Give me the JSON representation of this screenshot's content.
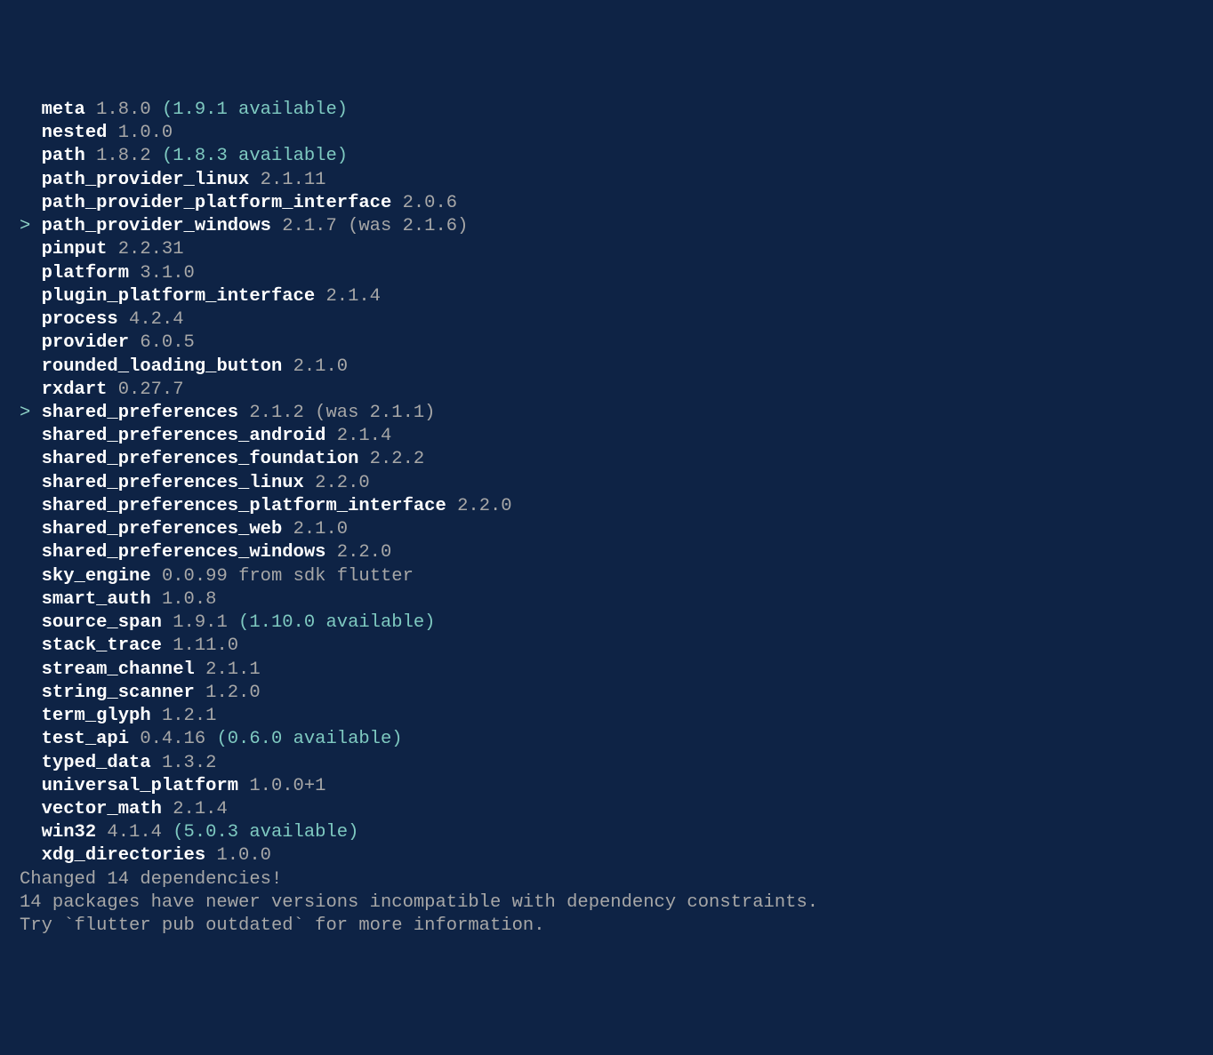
{
  "packages": [
    {
      "prefix": "  ",
      "name": "meta",
      "version": "1.8.0",
      "available": "(1.9.1 available)",
      "was": ""
    },
    {
      "prefix": "  ",
      "name": "nested",
      "version": "1.0.0",
      "available": "",
      "was": ""
    },
    {
      "prefix": "  ",
      "name": "path",
      "version": "1.8.2",
      "available": "(1.8.3 available)",
      "was": ""
    },
    {
      "prefix": "  ",
      "name": "path_provider_linux",
      "version": "2.1.11",
      "available": "",
      "was": ""
    },
    {
      "prefix": "  ",
      "name": "path_provider_platform_interface",
      "version": "2.0.6",
      "available": "",
      "was": ""
    },
    {
      "prefix": "> ",
      "name": "path_provider_windows",
      "version": "2.1.7",
      "available": "",
      "was": "(was 2.1.6)"
    },
    {
      "prefix": "  ",
      "name": "pinput",
      "version": "2.2.31",
      "available": "",
      "was": ""
    },
    {
      "prefix": "  ",
      "name": "platform",
      "version": "3.1.0",
      "available": "",
      "was": ""
    },
    {
      "prefix": "  ",
      "name": "plugin_platform_interface",
      "version": "2.1.4",
      "available": "",
      "was": ""
    },
    {
      "prefix": "  ",
      "name": "process",
      "version": "4.2.4",
      "available": "",
      "was": ""
    },
    {
      "prefix": "  ",
      "name": "provider",
      "version": "6.0.5",
      "available": "",
      "was": ""
    },
    {
      "prefix": "  ",
      "name": "rounded_loading_button",
      "version": "2.1.0",
      "available": "",
      "was": ""
    },
    {
      "prefix": "  ",
      "name": "rxdart",
      "version": "0.27.7",
      "available": "",
      "was": ""
    },
    {
      "prefix": "> ",
      "name": "shared_preferences",
      "version": "2.1.2",
      "available": "",
      "was": "(was 2.1.1)"
    },
    {
      "prefix": "  ",
      "name": "shared_preferences_android",
      "version": "2.1.4",
      "available": "",
      "was": ""
    },
    {
      "prefix": "  ",
      "name": "shared_preferences_foundation",
      "version": "2.2.2",
      "available": "",
      "was": ""
    },
    {
      "prefix": "  ",
      "name": "shared_preferences_linux",
      "version": "2.2.0",
      "available": "",
      "was": ""
    },
    {
      "prefix": "  ",
      "name": "shared_preferences_platform_interface",
      "version": "2.2.0",
      "available": "",
      "was": ""
    },
    {
      "prefix": "  ",
      "name": "shared_preferences_web",
      "version": "2.1.0",
      "available": "",
      "was": ""
    },
    {
      "prefix": "  ",
      "name": "shared_preferences_windows",
      "version": "2.2.0",
      "available": "",
      "was": ""
    },
    {
      "prefix": "  ",
      "name": "sky_engine",
      "version": "0.0.99",
      "available": "",
      "was": "",
      "from": "from sdk flutter"
    },
    {
      "prefix": "  ",
      "name": "smart_auth",
      "version": "1.0.8",
      "available": "",
      "was": ""
    },
    {
      "prefix": "  ",
      "name": "source_span",
      "version": "1.9.1",
      "available": "(1.10.0 available)",
      "was": ""
    },
    {
      "prefix": "  ",
      "name": "stack_trace",
      "version": "1.11.0",
      "available": "",
      "was": ""
    },
    {
      "prefix": "  ",
      "name": "stream_channel",
      "version": "2.1.1",
      "available": "",
      "was": ""
    },
    {
      "prefix": "  ",
      "name": "string_scanner",
      "version": "1.2.0",
      "available": "",
      "was": ""
    },
    {
      "prefix": "  ",
      "name": "term_glyph",
      "version": "1.2.1",
      "available": "",
      "was": ""
    },
    {
      "prefix": "  ",
      "name": "test_api",
      "version": "0.4.16",
      "available": "(0.6.0 available)",
      "was": ""
    },
    {
      "prefix": "  ",
      "name": "typed_data",
      "version": "1.3.2",
      "available": "",
      "was": ""
    },
    {
      "prefix": "  ",
      "name": "universal_platform",
      "version": "1.0.0+1",
      "available": "",
      "was": ""
    },
    {
      "prefix": "  ",
      "name": "vector_math",
      "version": "2.1.4",
      "available": "",
      "was": ""
    },
    {
      "prefix": "  ",
      "name": "win32",
      "version": "4.1.4",
      "available": "(5.0.3 available)",
      "was": ""
    },
    {
      "prefix": "  ",
      "name": "xdg_directories",
      "version": "1.0.0",
      "available": "",
      "was": ""
    }
  ],
  "footer": {
    "changed": "Changed 14 dependencies!",
    "warn": "14 packages have newer versions incompatible with dependency constraints.",
    "try": "Try `flutter pub outdated` for more information."
  }
}
